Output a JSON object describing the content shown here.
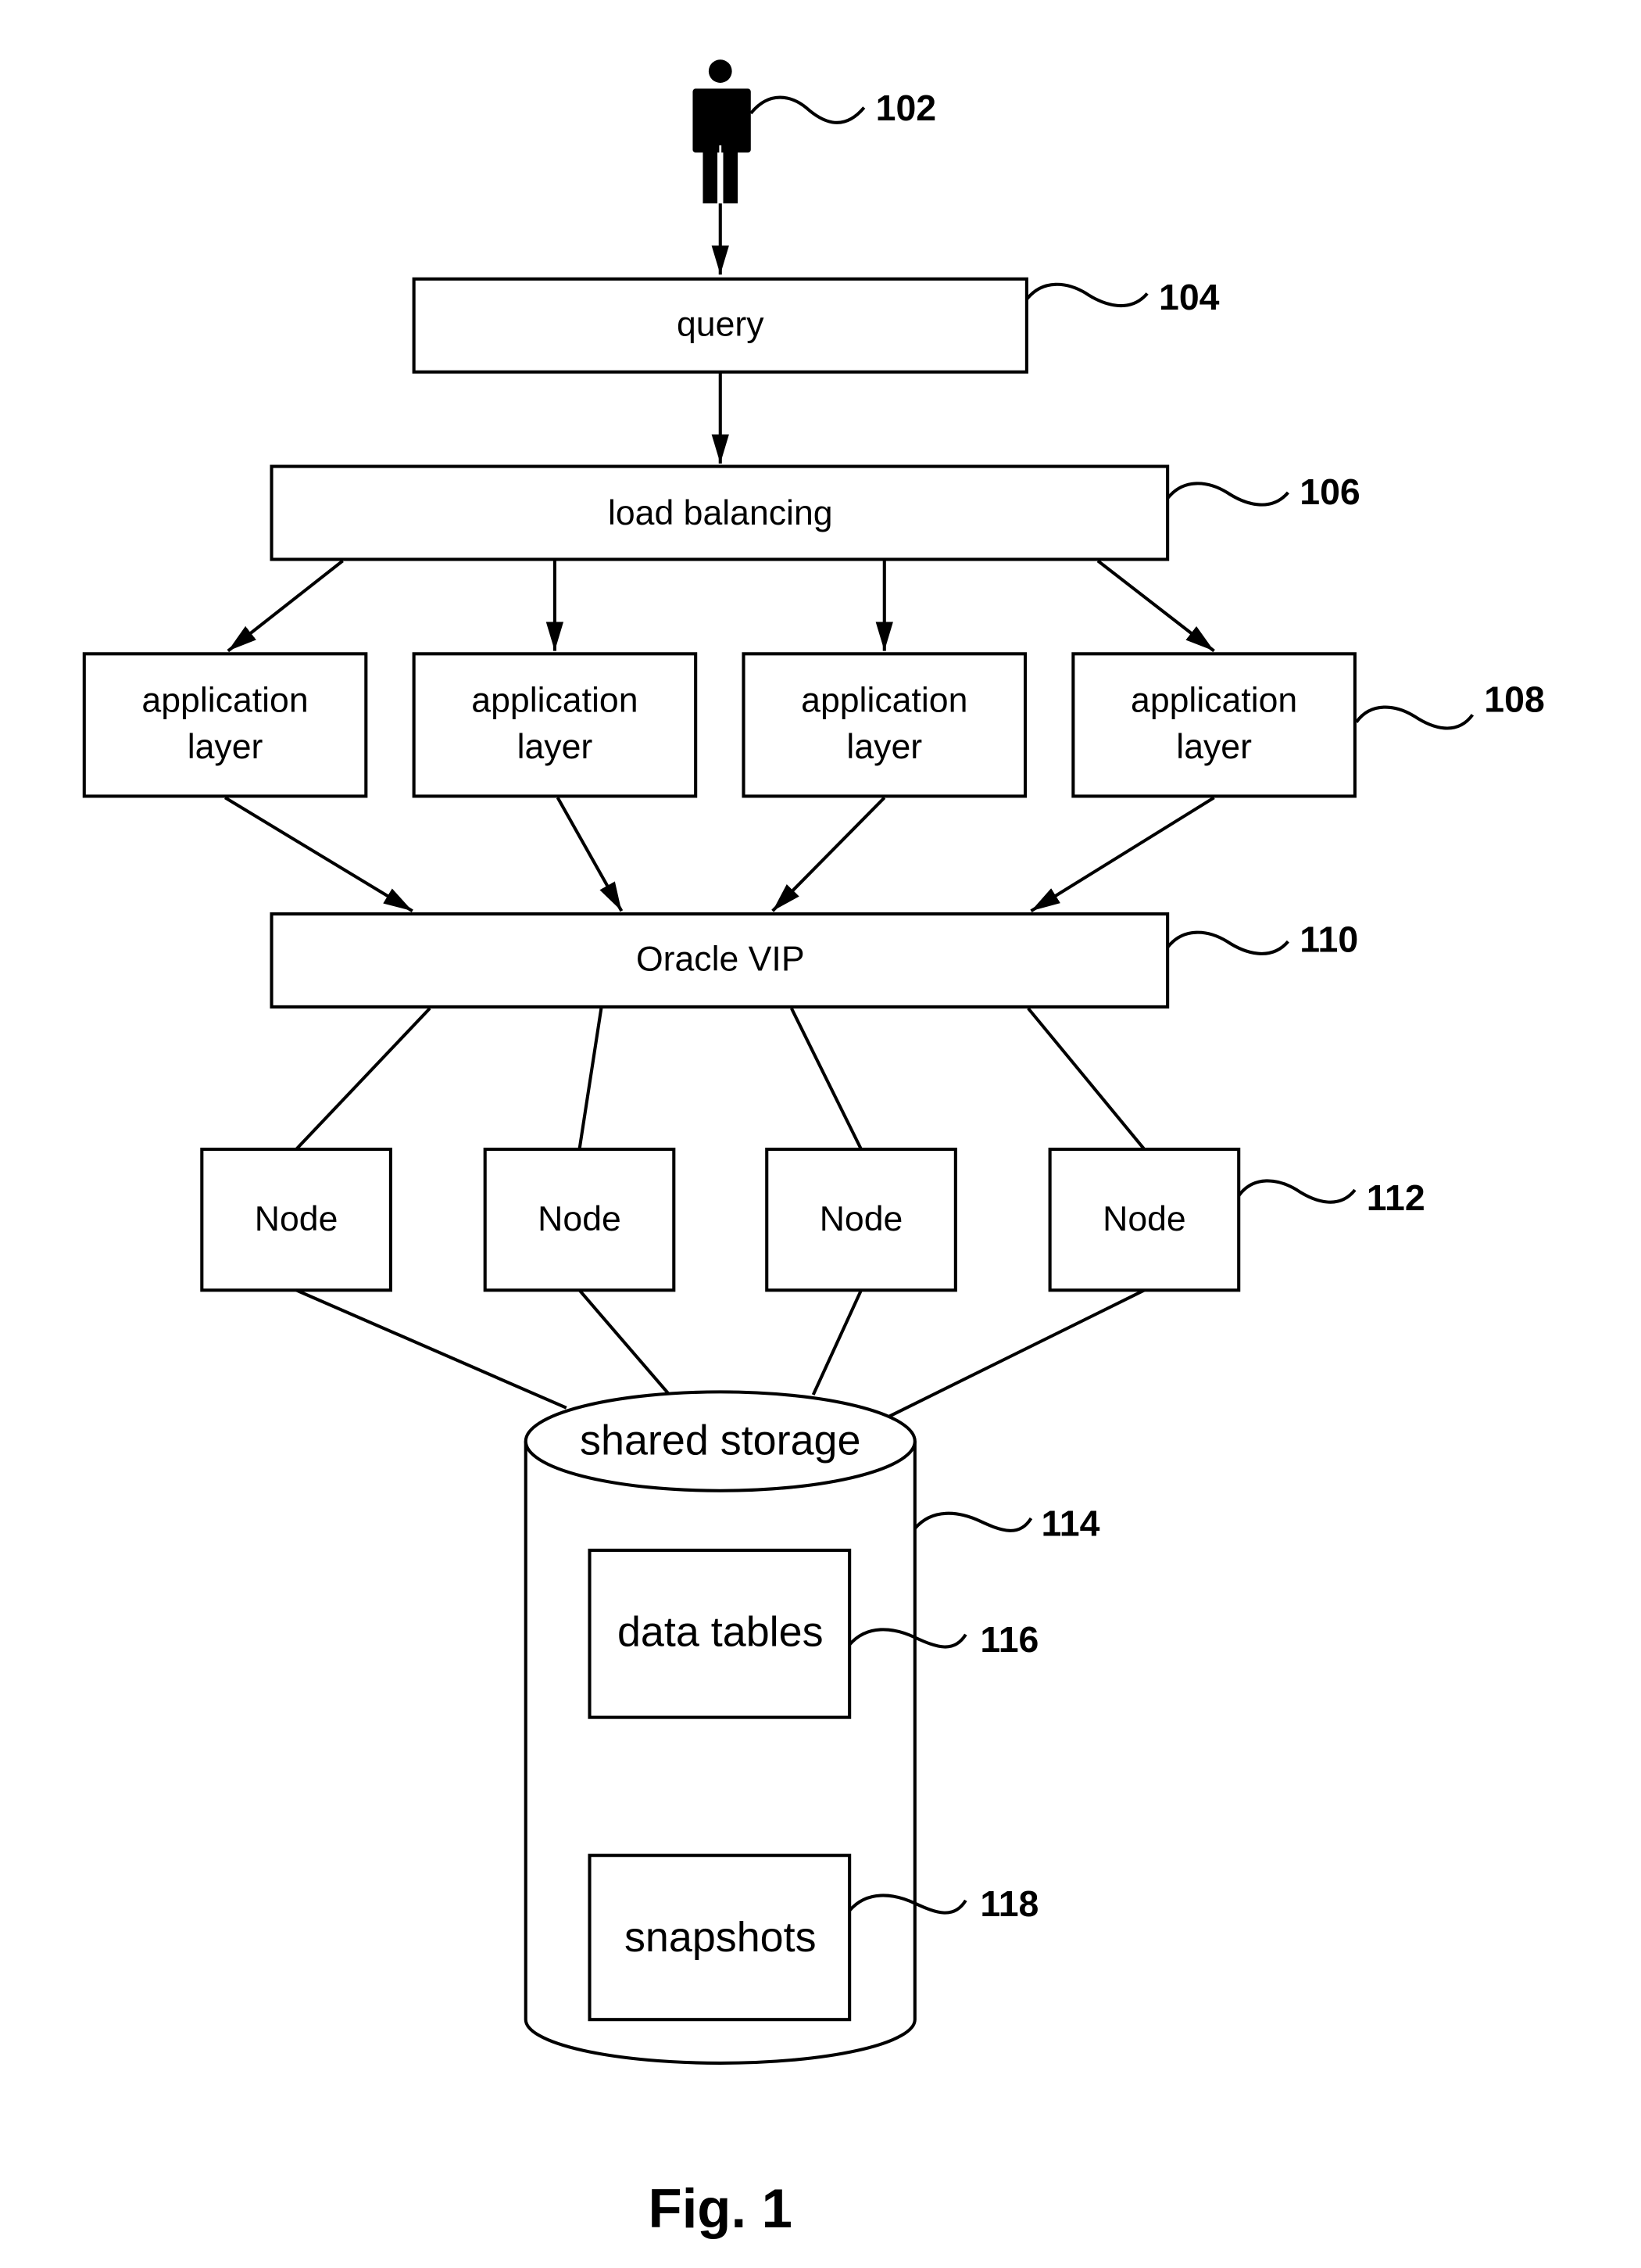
{
  "figure": {
    "caption": "Fig. 1",
    "user": {
      "ref": "102"
    },
    "query": {
      "label": "query",
      "ref": "104"
    },
    "load_balancer": {
      "label": "load balancing",
      "ref": "106"
    },
    "application_layers": {
      "ref": "108",
      "items": [
        {
          "line1": "application",
          "line2": "layer"
        },
        {
          "line1": "application",
          "line2": "layer"
        },
        {
          "line1": "application",
          "line2": "layer"
        },
        {
          "line1": "application",
          "line2": "layer"
        }
      ]
    },
    "oracle_vip": {
      "label": "Oracle VIP",
      "ref": "110"
    },
    "nodes": {
      "ref": "112",
      "items": [
        {
          "label": "Node"
        },
        {
          "label": "Node"
        },
        {
          "label": "Node"
        },
        {
          "label": "Node"
        }
      ]
    },
    "shared_storage": {
      "label": "shared storage",
      "ref": "114"
    },
    "data_tables": {
      "label": "data tables",
      "ref": "116"
    },
    "snapshots": {
      "label": "snapshots",
      "ref": "118"
    }
  }
}
